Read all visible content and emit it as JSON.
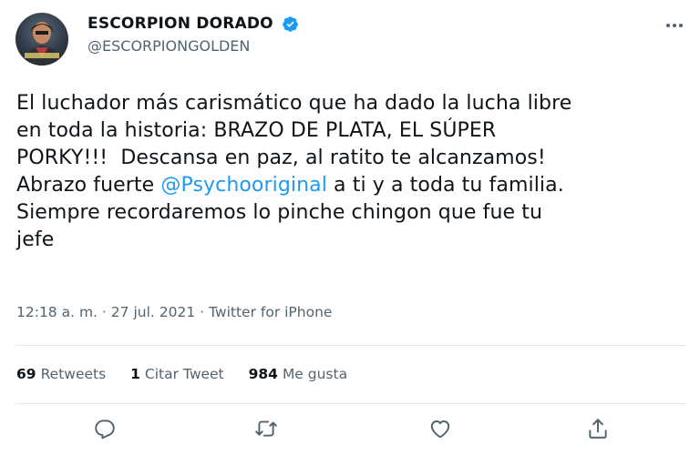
{
  "author": {
    "display_name": "ESCORPION DORADO",
    "handle": "@ESCORPIONGOLDEN",
    "verified": true,
    "avatar_text": "ESCORPION DORADO"
  },
  "tweet": {
    "text_before": "El luchador más carismático que ha dado la lucha libre\nen toda la historia: BRAZO DE PLATA, EL SÚPER\nPORKY!!!  Descansa en paz, al ratito te alcanzamos!\nAbrazo fuerte ",
    "mention": "@Psychooriginal",
    "text_after": " a ti y a toda tu familia.\nSiempre recordaremos lo pinche chingon que fue tu\njefe"
  },
  "meta": {
    "time": "12:18 a. m.",
    "date": "27 jul. 2021",
    "source": "Twitter for iPhone",
    "separator": "·"
  },
  "stats": {
    "retweets_count": "69",
    "retweets_label": "Retweets",
    "quotes_count": "1",
    "quotes_label": "Citar Tweet",
    "likes_count": "984",
    "likes_label": "Me gusta"
  },
  "actions": [
    "reply-icon",
    "retweet-icon",
    "like-icon",
    "share-icon"
  ],
  "colors": {
    "accent": "#1d9bf0",
    "muted": "#536471",
    "divider": "#e1e8ed"
  }
}
